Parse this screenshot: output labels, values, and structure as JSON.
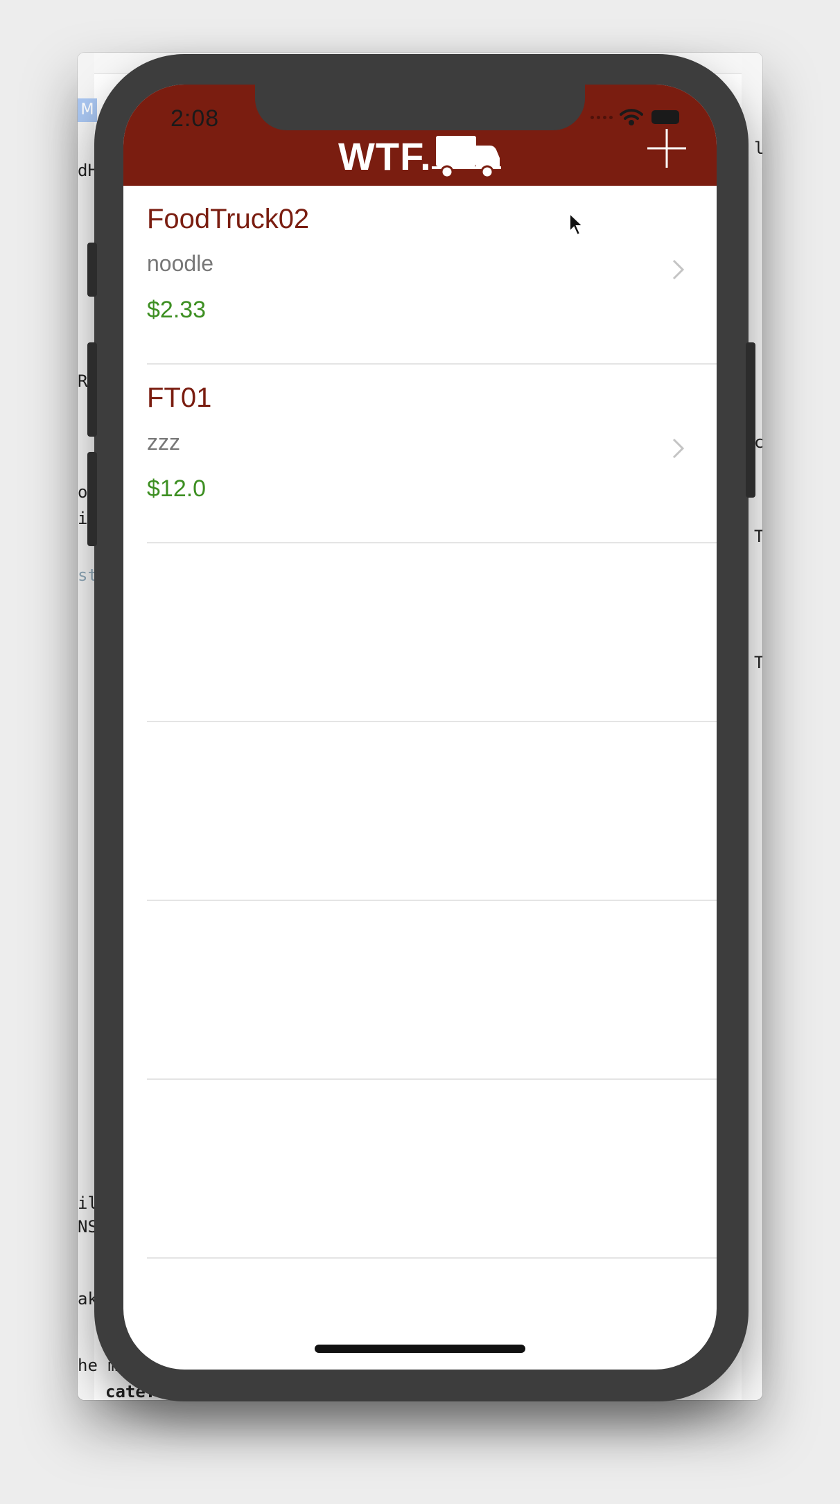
{
  "status_bar": {
    "time": "2:08"
  },
  "nav": {
    "title": "WTF.",
    "logo_icon": "truck-icon",
    "add_icon": "plus-icon"
  },
  "food_trucks": [
    {
      "name": "FoodTruck02",
      "category": "noodle",
      "price": "$2.33"
    },
    {
      "name": "FT01",
      "category": "zzz",
      "price": "$12.0"
    }
  ],
  "background_text": {
    "badge": "M",
    "fragments": [
      "dH",
      "R",
      "o",
      "i",
      "st",
      "il",
      "NS",
      "ak",
      "he m",
      "T",
      "T",
      "lo",
      "c"
    ],
    "bottom_line": "cate... may"
  },
  "colors": {
    "header": "#7a1d10",
    "title_text": "#7a1d10",
    "price_text": "#3d8f22",
    "subtitle_text": "#777777"
  }
}
